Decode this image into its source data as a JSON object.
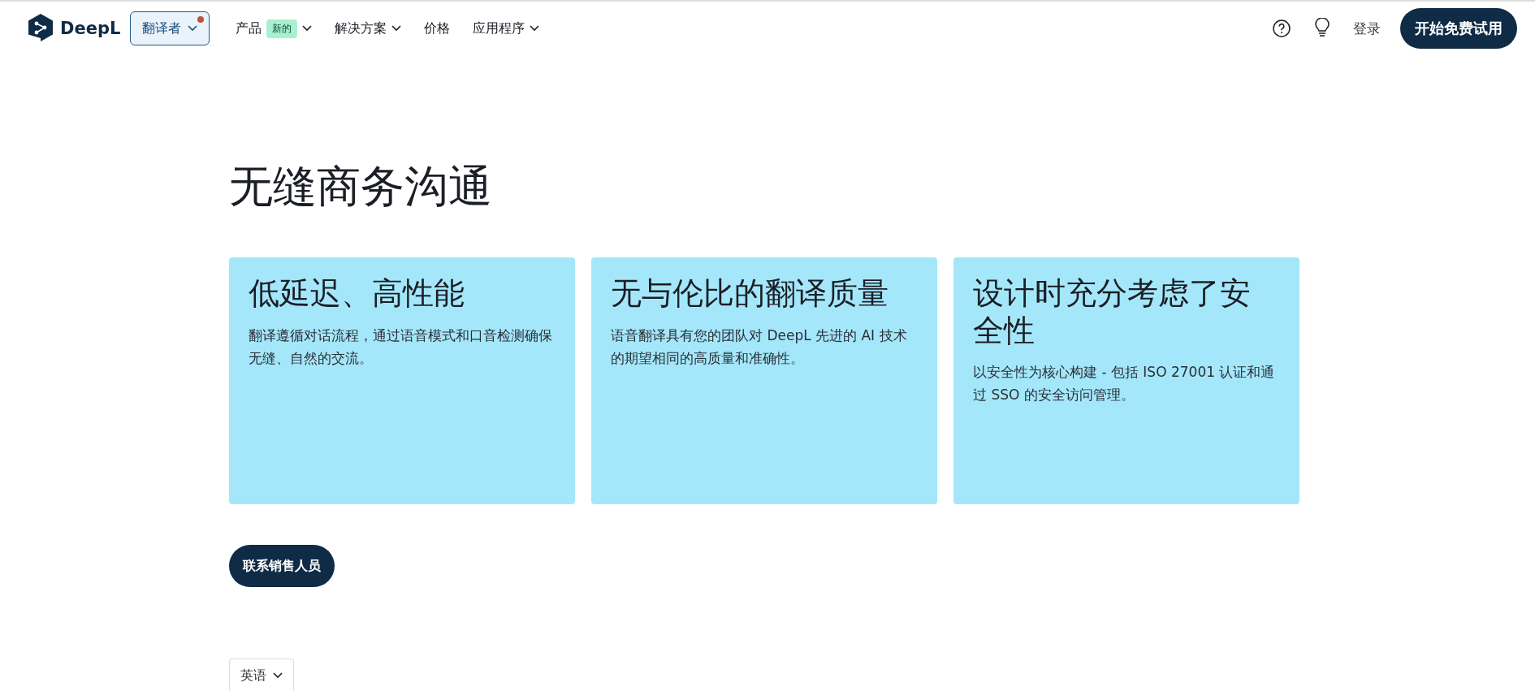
{
  "nav": {
    "logo": "DeepL",
    "translator": {
      "label": "翻译者",
      "notification": true
    },
    "items": [
      {
        "label": "产品",
        "badge": "新的",
        "dropdown": true
      },
      {
        "label": "解决方案",
        "dropdown": true
      },
      {
        "label": "价格",
        "dropdown": false
      },
      {
        "label": "应用程序",
        "dropdown": true
      }
    ],
    "login": "登录",
    "cta": "开始免费试用"
  },
  "heading": "无缝商务沟通",
  "cards": [
    {
      "title": "低延迟、高性能",
      "text": "翻译遵循对话流程，通过语音模式和口音检测确保无缝、自然的交流。"
    },
    {
      "title": "无与伦比的翻译质量",
      "text": "语音翻译具有您的团队对 DeepL 先进的 AI 技术的期望相同的高质量和准确性。"
    },
    {
      "title": "设计时充分考虑了安全性",
      "text": "以安全性为核心构建 - 包括 ISO 27001 认证和通过 SSO 的安全访问管理。"
    }
  ],
  "contact_button": "联系销售人员",
  "language": "英语"
}
